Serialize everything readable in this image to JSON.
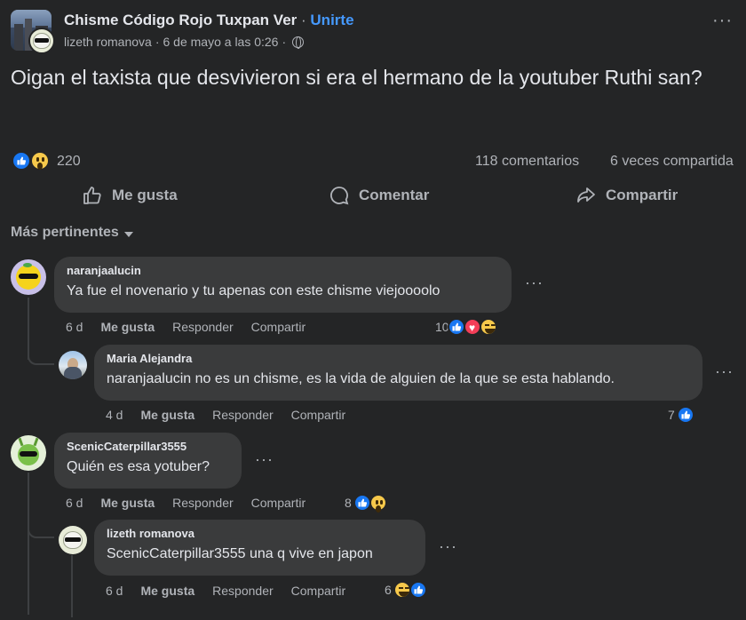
{
  "header": {
    "group_name": "Chisme Código Rojo Tuxpan Ver",
    "separator": "·",
    "join_label": "Unirte",
    "author": "lizeth romanova",
    "timestamp": "6 de mayo a las 0:26",
    "privacy_icon": "globe-icon",
    "more_icon": "more-options-icon"
  },
  "post": {
    "text": "Oigan el taxista que desvivieron si era el hermano de la youtuber Ruthi san?"
  },
  "stats": {
    "reaction_count": "220",
    "comments": "118 comentarios",
    "shares": "6 veces compartida"
  },
  "actions": {
    "like": "Me gusta",
    "comment": "Comentar",
    "share": "Compartir"
  },
  "sort": {
    "label": "Más pertinentes"
  },
  "comments": [
    {
      "name": "naranjaalucin",
      "text": "Ya fue el novenario y tu apenas con este chisme viejoooolo",
      "age": "6 d",
      "like": "Me gusta",
      "reply": "Responder",
      "share": "Compartir",
      "reactions": "10"
    },
    {
      "name": "Maria Alejandra",
      "text": "naranjaalucin no es un chisme, es la vida de alguien de la que se esta hablando.",
      "age": "4 d",
      "like": "Me gusta",
      "reply": "Responder",
      "share": "Compartir",
      "reactions": "7"
    },
    {
      "name": "ScenicCaterpillar3555",
      "text": "Quién es esa yotuber?",
      "age": "6 d",
      "like": "Me gusta",
      "reply": "Responder",
      "share": "Compartir",
      "reactions": "8"
    },
    {
      "name": "lizeth romanova",
      "text": "ScenicCaterpillar3555 una q vive en japon",
      "age": "6 d",
      "like": "Me gusta",
      "reply": "Responder",
      "share": "Compartir",
      "reactions": "6"
    }
  ],
  "colors": {
    "background": "#242526",
    "bubble": "#3a3b3c",
    "primary_text": "#e4e6eb",
    "secondary_text": "#b0b3b8",
    "link_blue": "#4599ff",
    "like_blue": "#1877f2",
    "love_red": "#f33e58",
    "wow_yellow": "#f7c94b"
  }
}
